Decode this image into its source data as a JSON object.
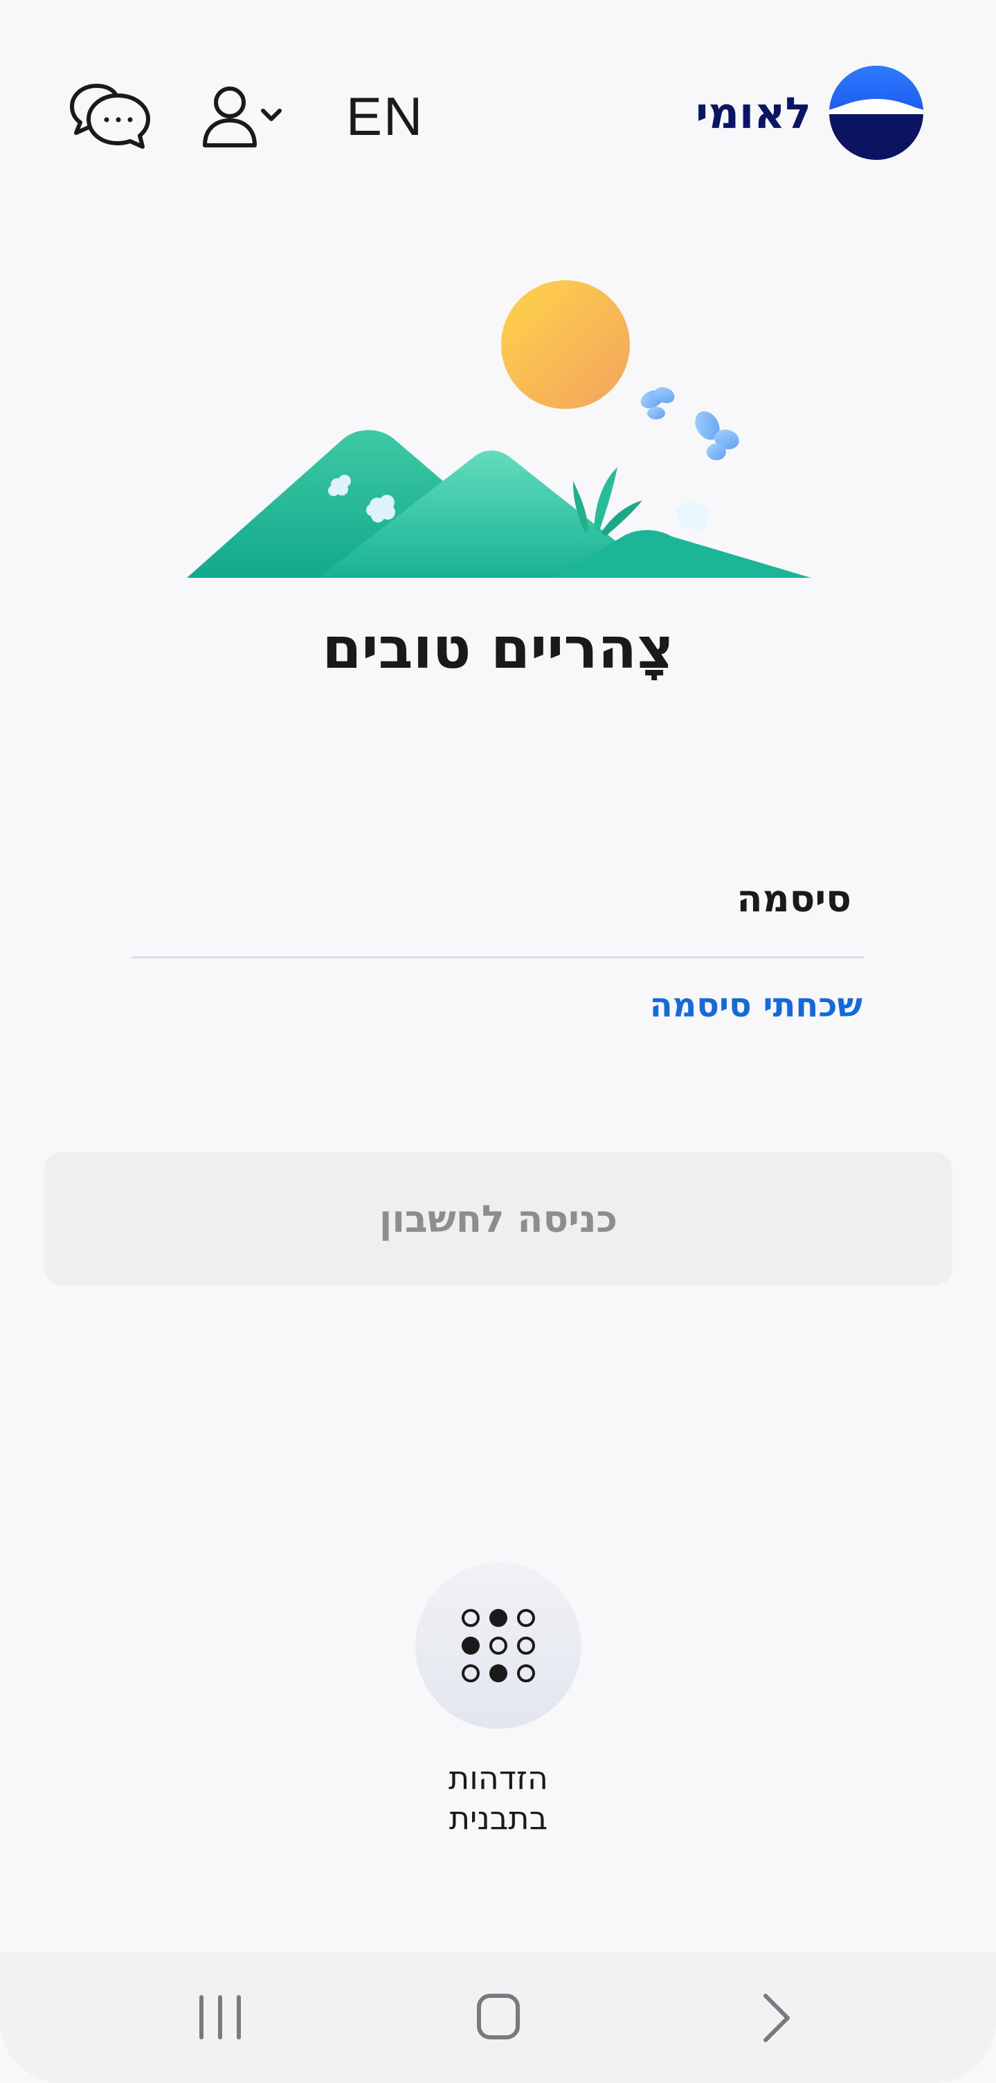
{
  "header": {
    "chat_icon": "chat-bubbles-icon",
    "profile_icon": "user-icon",
    "language_label": "EN",
    "brand_name": "לאומי",
    "brand_logo_icon": "leumi-logo-icon"
  },
  "illustration": {
    "icon": "mountains-sun-illustration",
    "greeting": "צָהריים טובים"
  },
  "login_form": {
    "password_label": "סיסמה",
    "password_value": "",
    "forgot_password_link": "שכחתי סיסמה",
    "submit_button": "כניסה לחשבון"
  },
  "pattern_login": {
    "icon": "pattern-grid-icon",
    "label_line1": "הזדהות",
    "label_line2": "בתבנית"
  },
  "nav_bar": {
    "recent_icon": "recent-apps-icon",
    "home_icon": "home-icon",
    "back_icon": "back-icon"
  },
  "colors": {
    "brand_navy": "#0b1566",
    "link_blue": "#1469dc",
    "button_bg": "#efeff0",
    "button_text": "#8d8d90",
    "hill_green": "#1db597",
    "sun": "#f7c14a"
  }
}
